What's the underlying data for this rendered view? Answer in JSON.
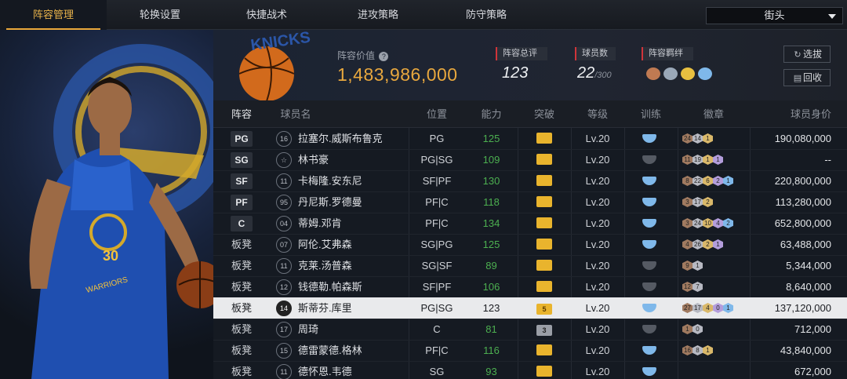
{
  "tabs": [
    {
      "label": "阵容管理",
      "active": true
    },
    {
      "label": "轮换设置",
      "active": false
    },
    {
      "label": "快捷战术",
      "active": false
    },
    {
      "label": "进攻策略",
      "active": false
    },
    {
      "label": "防守策略",
      "active": false
    }
  ],
  "mode_select": {
    "value": "街头"
  },
  "header": {
    "value_label": "阵容价值",
    "value": "1,483,986,000",
    "overall_label": "阵容总评",
    "overall": "123",
    "count_label": "球员数",
    "count": "22",
    "count_max": "/300",
    "bonds_label": "阵容羁绊",
    "pick_button": "选拔",
    "recycle_button": "回收"
  },
  "columns": {
    "lineup": "阵容",
    "name": "球员名",
    "position": "位置",
    "ability": "能力",
    "breakthrough": "突破",
    "level": "等级",
    "training": "训练",
    "badges": "徽章",
    "value": "球员身价"
  },
  "players": [
    {
      "slot": "PG",
      "number": "16",
      "name": "拉塞尔.威斯布鲁克",
      "position": "PG",
      "ability": "125",
      "break": "",
      "level": "Lv.20",
      "training": "on",
      "badges": [
        "24",
        "14",
        "1"
      ],
      "value": "190,080,000"
    },
    {
      "slot": "SG",
      "number": "☆",
      "name": "林书豪",
      "position": "PG|SG",
      "ability": "109",
      "break": "",
      "level": "Lv.20",
      "training": "off",
      "badges": [
        "11",
        "19",
        "1",
        "1"
      ],
      "value": "--"
    },
    {
      "slot": "SF",
      "number": "11",
      "name": "卡梅隆.安东尼",
      "position": "SF|PF",
      "ability": "130",
      "break": "",
      "level": "Lv.20",
      "training": "on",
      "badges": [
        "8",
        "22",
        "6",
        "2",
        "1"
      ],
      "value": "220,800,000"
    },
    {
      "slot": "PF",
      "number": "95",
      "name": "丹尼斯.罗德曼",
      "position": "PF|C",
      "ability": "118",
      "break": "",
      "level": "Lv.20",
      "training": "on",
      "badges": [
        "3",
        "17",
        "2"
      ],
      "value": "113,280,000"
    },
    {
      "slot": "C",
      "number": "04",
      "name": "蒂姆.邓肯",
      "position": "PF|C",
      "ability": "134",
      "break": "",
      "level": "Lv.20",
      "training": "on",
      "badges": [
        "3",
        "24",
        "10",
        "4",
        "2"
      ],
      "value": "652,800,000"
    },
    {
      "slot": "板凳",
      "number": "07",
      "name": "阿伦.艾弗森",
      "position": "SG|PG",
      "ability": "125",
      "break": "",
      "level": "Lv.20",
      "training": "on",
      "badges": [
        "4",
        "26",
        "2",
        "1"
      ],
      "value": "63,488,000"
    },
    {
      "slot": "板凳",
      "number": "11",
      "name": "克莱.汤普森",
      "position": "SG|SF",
      "ability": "89",
      "break": "",
      "level": "Lv.20",
      "training": "off",
      "badges": [
        "9",
        "1"
      ],
      "value": "5,344,000"
    },
    {
      "slot": "板凳",
      "number": "12",
      "name": "钱德勒.帕森斯",
      "position": "SF|PF",
      "ability": "106",
      "break": "",
      "level": "Lv.20",
      "training": "off",
      "badges": [
        "12",
        "7"
      ],
      "value": "8,640,000"
    },
    {
      "slot": "板凳",
      "number": "14",
      "name": "斯蒂芬.库里",
      "position": "PG|SG",
      "ability": "123",
      "break": "5",
      "level": "Lv.20",
      "training": "on",
      "badges": [
        "27",
        "17",
        "4",
        "0",
        "1"
      ],
      "value": "137,120,000",
      "highlight": true
    },
    {
      "slot": "板凳",
      "number": "17",
      "name": "周琦",
      "position": "C",
      "ability": "81",
      "break": "3",
      "level": "Lv.20",
      "training": "off",
      "badges": [
        "1",
        "0"
      ],
      "value": "712,000"
    },
    {
      "slot": "板凳",
      "number": "15",
      "name": "德雷蒙德.格林",
      "position": "PF|C",
      "ability": "116",
      "break": "",
      "level": "Lv.20",
      "training": "on",
      "badges": [
        "16",
        "8",
        "1"
      ],
      "value": "43,840,000"
    },
    {
      "slot": "板凳",
      "number": "11",
      "name": "德怀恩.韦德",
      "position": "SG",
      "ability": "93",
      "break": "",
      "level": "Lv.20",
      "training": "on",
      "badges": [],
      "value": "672,000"
    }
  ],
  "colors": {
    "accent": "#e9a83e",
    "green": "#4caf50",
    "highlight_row": "#e9eaec",
    "training_on": "#7fb8ea"
  },
  "art": {
    "jersey_number": "30",
    "team_text": "WARRIORS",
    "logo_text": "KNICKS"
  }
}
